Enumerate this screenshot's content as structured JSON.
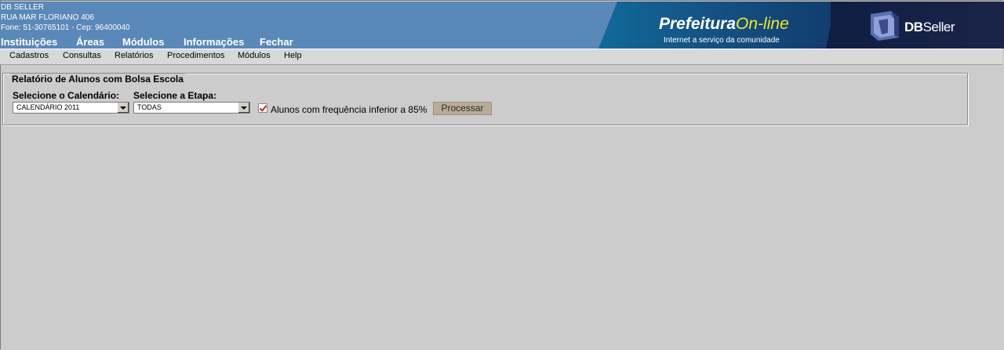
{
  "company": {
    "name": "DB SELLER",
    "address": "RUA MAR FLORIANO 406",
    "contact": "Fone: 51-30765101  -  Cep: 96400040"
  },
  "top_nav": [
    "Instituições",
    "Áreas",
    "Módulos",
    "Informações",
    "Fechar"
  ],
  "banner": {
    "prefeitura": "Prefeitura",
    "online": "On-line",
    "tagline": "Internet a serviço da comunidade",
    "db_bold": "DB",
    "db_rest": "Seller"
  },
  "menu": [
    "Cadastros",
    "Consultas",
    "Relatórios",
    "Procedimentos",
    "Módulos",
    "Help"
  ],
  "form": {
    "legend": "Relatório de Alunos com Bolsa Escola",
    "calendar_label": "Selecione o Calendário:",
    "calendar_value": "CALENDÁRIO 2011",
    "etapa_label": "Selecione a Etapa:",
    "etapa_value": "TODAS",
    "checkbox_label": "Alunos com frequência inferior a 85%",
    "checkbox_checked": true,
    "process_button": "Processar"
  },
  "colors": {
    "header_blue": "#5a88b8",
    "page_bg": "#cccccc",
    "button_bg": "#b8ab98",
    "online_yellow": "#f2e52b",
    "check_red": "#d02020"
  }
}
